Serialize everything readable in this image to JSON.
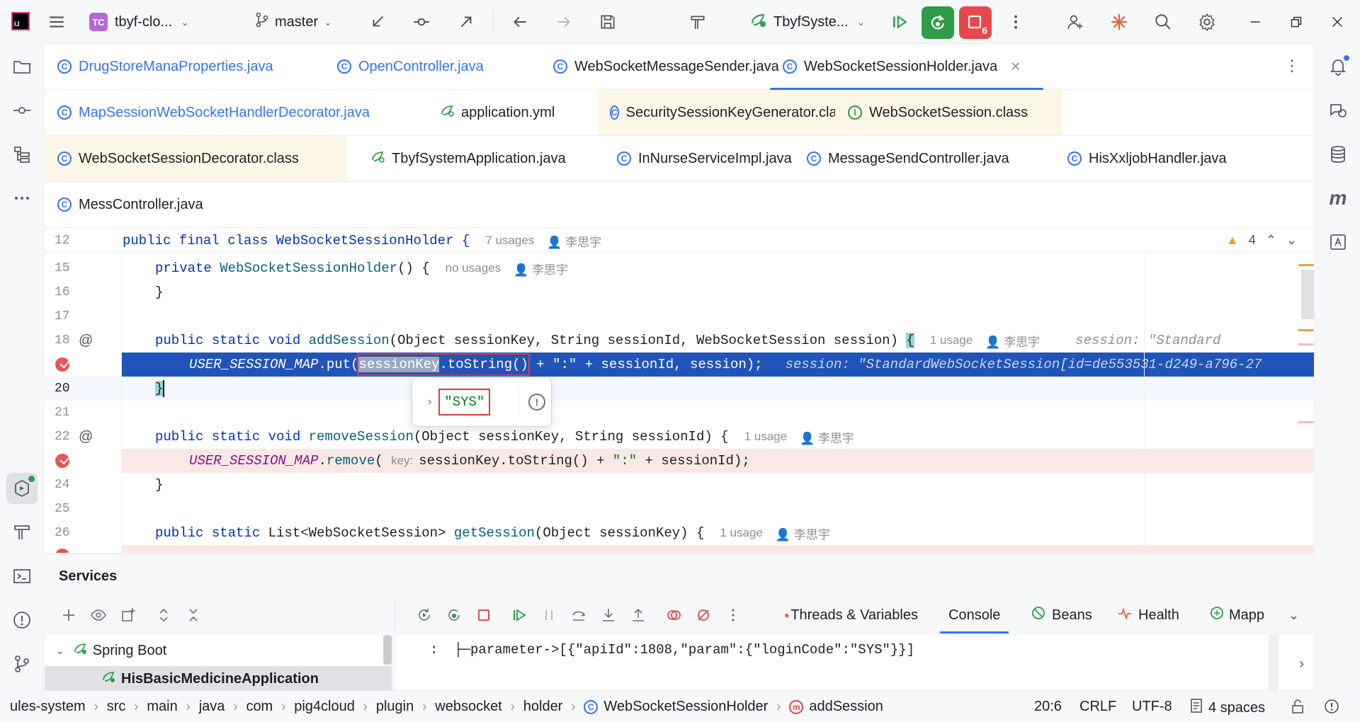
{
  "toolbar": {
    "project_badge": "TC",
    "project_name": "tbyf-clo...",
    "branch": "master",
    "run_config": "TbyfSyste...",
    "run_badge_count": "6"
  },
  "tabs": {
    "row1": [
      {
        "label": "DrugStoreManaProperties.java",
        "kind": "java"
      },
      {
        "label": "OpenController.java",
        "kind": "java"
      },
      {
        "label": "WebSocketMessageSender.java",
        "kind": "java-gray"
      },
      {
        "label": "WebSocketSessionHolder.java",
        "kind": "active"
      }
    ],
    "row2": [
      {
        "label": "MapSessionWebSocketHandlerDecorator.java",
        "kind": "java"
      },
      {
        "label": "application.yml",
        "kind": "yml"
      },
      {
        "label": "SecuritySessionKeyGenerator.class",
        "kind": "class"
      },
      {
        "label": "WebSocketSession.class",
        "kind": "interface"
      }
    ],
    "row3": [
      {
        "label": "WebSocketSessionDecorator.class",
        "kind": "class"
      },
      {
        "label": "TbyfSystemApplication.java",
        "kind": "app"
      },
      {
        "label": "InNurseServiceImpl.java",
        "kind": "java-gray"
      },
      {
        "label": "MessageSendController.java",
        "kind": "java-gray"
      },
      {
        "label": "HisXxljobHandler.java",
        "kind": "java-gray"
      }
    ],
    "row4": [
      {
        "label": "MessController.java",
        "kind": "java-gray"
      }
    ]
  },
  "editor": {
    "sticky": {
      "line": "12",
      "code": "public final class WebSocketSessionHolder {",
      "usages": "7 usages",
      "author": "李思宇"
    },
    "warnings": "4",
    "lines": {
      "l15": {
        "num": "15",
        "usage": "no usages",
        "author": "李思宇"
      },
      "l16": {
        "num": "16"
      },
      "l17": {
        "num": "17"
      },
      "l18": {
        "num": "18",
        "usage": "1 usage",
        "author": "李思宇",
        "inline": "session: \"Standard"
      },
      "l19": {
        "inline": "session: \"StandardWebSocketSession[id=de553531-d249-a796-27"
      },
      "l20": {
        "num": "20"
      },
      "l21": {
        "num": "21"
      },
      "l22": {
        "num": "22",
        "usage": "1 usage",
        "author": "李思宇"
      },
      "l23": {
        "param_hint": "key:"
      },
      "l24": {
        "num": "24"
      },
      "l25": {
        "num": "25"
      },
      "l26": {
        "num": "26",
        "usage": "1 usage",
        "author": "李思宇"
      }
    },
    "popup_value": "\"SYS\""
  },
  "services": {
    "title": "Services",
    "tabs": [
      "Threads & Variables",
      "Console",
      "Beans",
      "Health",
      "Mapp"
    ],
    "tree": [
      "Spring Boot",
      "HisBasicMedicineApplication"
    ],
    "console_line": ":  ├─parameter->[{\"apiId\":1808,\"param\":{\"loginCode\":\"SYS\"}}]"
  },
  "statusbar": {
    "crumbs": [
      "ules-system",
      "src",
      "main",
      "java",
      "com",
      "pig4cloud",
      "plugin",
      "websocket",
      "holder",
      "WebSocketSessionHolder",
      "addSession"
    ],
    "position": "20:6",
    "line_sep": "CRLF",
    "encoding": "UTF-8",
    "indent": "4 spaces"
  },
  "colors": {
    "accent": "#3574f0",
    "selection": "#2154b8",
    "breakpoint_line": "#fae8e6",
    "breakpoint": "#e55757",
    "run_green": "#2d9d4a",
    "stop_red": "#e5484d"
  }
}
